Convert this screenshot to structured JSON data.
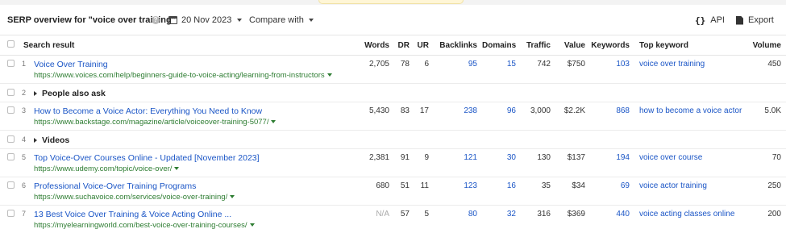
{
  "header": {
    "title": "SERP overview for \"voice over training\"",
    "help_icon": "question-circle-icon",
    "date": "20 Nov 2023",
    "compare_label": "Compare with",
    "api_label": "API",
    "export_label": "Export"
  },
  "table": {
    "columns": {
      "search_result": "Search result",
      "words": "Words",
      "dr": "DR",
      "ur": "UR",
      "backlinks": "Backlinks",
      "domains": "Domains",
      "traffic": "Traffic",
      "value": "Value",
      "keywords": "Keywords",
      "top_keyword": "Top keyword",
      "volume": "Volume"
    },
    "rows": [
      {
        "num": "1",
        "title": "Voice Over Training",
        "url": "https://www.voices.com/help/beginners-guide-to-voice-acting/learning-from-instructors",
        "words": "2,705",
        "dr": "78",
        "ur": "6",
        "backlinks": "95",
        "domains": "15",
        "traffic": "742",
        "value": "$750",
        "keywords": "103",
        "top_keyword": "voice over training",
        "volume": "450"
      },
      {
        "num": "2",
        "group": "People also ask"
      },
      {
        "num": "3",
        "title": "How to Become a Voice Actor: Everything You Need to Know",
        "url": "https://www.backstage.com/magazine/article/voiceover-training-5077/",
        "words": "5,430",
        "dr": "83",
        "ur": "17",
        "backlinks": "238",
        "domains": "96",
        "traffic": "3,000",
        "value": "$2.2K",
        "keywords": "868",
        "top_keyword": "how to become a voice actor",
        "volume": "5.0K"
      },
      {
        "num": "4",
        "group": "Videos"
      },
      {
        "num": "5",
        "title": "Top Voice-Over Courses Online - Updated [November 2023]",
        "url": "https://www.udemy.com/topic/voice-over/",
        "words": "2,381",
        "dr": "91",
        "ur": "9",
        "backlinks": "121",
        "domains": "30",
        "traffic": "130",
        "value": "$137",
        "keywords": "194",
        "top_keyword": "voice over course",
        "volume": "70"
      },
      {
        "num": "6",
        "title": "Professional Voice-Over Training Programs",
        "url": "https://www.suchavoice.com/services/voice-over-training/",
        "words": "680",
        "dr": "51",
        "ur": "11",
        "backlinks": "123",
        "domains": "16",
        "traffic": "35",
        "value": "$34",
        "keywords": "69",
        "top_keyword": "voice actor training",
        "volume": "250"
      },
      {
        "num": "7",
        "title": "13 Best Voice Over Training & Voice Acting Online ...",
        "url": "https://myelearningworld.com/best-voice-over-training-courses/",
        "words": "N/A",
        "dr": "57",
        "ur": "5",
        "backlinks": "80",
        "domains": "32",
        "traffic": "316",
        "value": "$369",
        "keywords": "440",
        "top_keyword": "voice acting classes online",
        "volume": "200"
      }
    ]
  }
}
